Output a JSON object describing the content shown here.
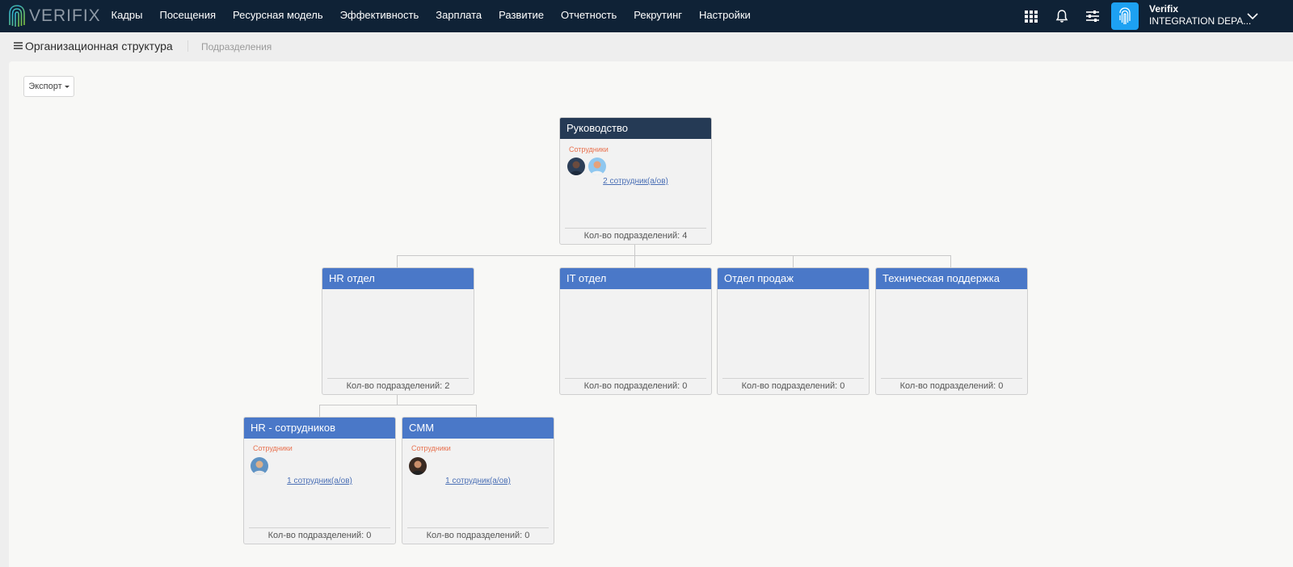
{
  "brand": {
    "logo_text": "VERIFIX"
  },
  "nav": {
    "items": [
      "Кадры",
      "Посещения",
      "Ресурсная модель",
      "Эффективность",
      "Зарплата",
      "Развитие",
      "Отчетность",
      "Рекрутинг",
      "Настройки"
    ]
  },
  "user": {
    "name": "Verifix",
    "department": "INTEGRATION DEPA..."
  },
  "breadcrumb": {
    "title": "Организационная структура",
    "sub": "Подразделения"
  },
  "toolbar": {
    "export_label": "Экспорт"
  },
  "org": {
    "root": {
      "title": "Руководство",
      "employees_label": "Сотрудники",
      "employees_link": "2 сотрудник(а/ов)",
      "footer": "Кол-во подразделений: 4"
    },
    "level1": [
      {
        "title": "HR отдел",
        "footer": "Кол-во подразделений: 2"
      },
      {
        "title": "IT отдел",
        "footer": "Кол-во подразделений: 0"
      },
      {
        "title": "Отдел продаж",
        "footer": "Кол-во подразделений: 0"
      },
      {
        "title": "Техническая поддержка",
        "footer": "Кол-во подразделений: 0"
      }
    ],
    "level2": [
      {
        "title": "HR - сотрудников",
        "employees_label": "Сотрудники",
        "employees_link": "1 сотрудник(а/ов)",
        "footer": "Кол-во подразделений: 0"
      },
      {
        "title": "CMM",
        "employees_label": "Сотрудники",
        "employees_link": "1 сотрудник(а/ов)",
        "footer": "Кол-во подразделений: 0"
      }
    ]
  },
  "colors": {
    "topbar": "#0f2236",
    "node_header": "#4a78c8",
    "root_header": "#253a55",
    "employees_label": "#e8714f",
    "link": "#4a6fb5",
    "user_tile": "#1da1f2"
  },
  "icons": [
    "verifix-logo-icon",
    "apps-grid-icon",
    "bell-icon",
    "sliders-icon",
    "fingerprint-icon",
    "chevron-down-icon",
    "hamburger-menu-icon",
    "caret-down-icon"
  ]
}
